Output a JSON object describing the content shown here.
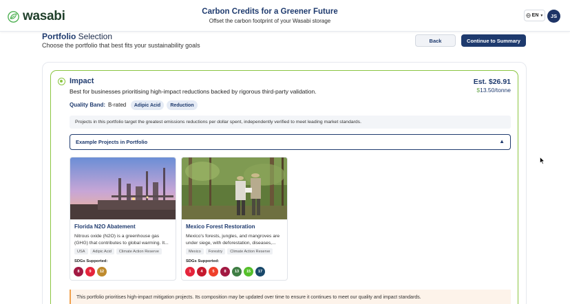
{
  "header": {
    "logo_text": "wasabi",
    "title": "Carbon Credits for a Greener Future",
    "subtitle": "Offset the carbon footprint of your Wasabi storage",
    "language": "EN",
    "avatar_initials": "JS"
  },
  "page": {
    "title_bold": "Portfolio",
    "title_rest": " Selection",
    "subtitle": "Choose the portfolio that best fits your sustainability goals",
    "back_label": "Back",
    "continue_label": "Continue to Summary"
  },
  "portfolio": {
    "name": "Impact",
    "description": "Best for businesses prioritising high-impact reductions backed by rigorous third-party validation.",
    "estimate": "Est. $26.91",
    "price_symbol": "$",
    "price_rest": "13.50/tonne",
    "quality_label": "Quality Band:",
    "quality_value": "B-rated",
    "tags": [
      "Adipic Acid",
      "Reduction"
    ],
    "info_text": "Projects in this portfolio target the greatest emissions reductions per dollar spent, independently verified to meet leading market standards.",
    "accordion_label": "Example Projects in Portfolio",
    "notice": "This portfolio prioritises high-impact mitigation projects. Its composition may be updated over time to ensure it continues to meet our quality and impact standards."
  },
  "projects": [
    {
      "title": "Florida N2O Abatement",
      "description": "Nitrous oxide (N2O) is a greenhouse gas (GHG) that contributes to global warming. It...",
      "tags": [
        "USA",
        "Adipic Acid",
        "Climate Action Reserve"
      ],
      "sdg_label": "SDGs Supported:",
      "sdgs": [
        {
          "num": "8",
          "color": "#a21942"
        },
        {
          "num": "9",
          "color": "#e5243b"
        },
        {
          "num": "12",
          "color": "#bf8b2e"
        }
      ]
    },
    {
      "title": "Mexico Forest Restoration",
      "description": "Mexico's forests, jungles, and mangroves are under siege, with deforestation, diseases,...",
      "tags": [
        "Mexico",
        "Forestry",
        "Climate Action Reserve"
      ],
      "sdg_label": "SDGs Supported:",
      "sdgs": [
        {
          "num": "1",
          "color": "#e5243b"
        },
        {
          "num": "4",
          "color": "#c5192d"
        },
        {
          "num": "5",
          "color": "#ef402b"
        },
        {
          "num": "8",
          "color": "#a21942"
        },
        {
          "num": "13",
          "color": "#3f7e44"
        },
        {
          "num": "15",
          "color": "#56c02b"
        },
        {
          "num": "17",
          "color": "#19486a"
        }
      ]
    }
  ],
  "colors": {
    "accent_green": "#8ac540",
    "navy": "#1e3a6e"
  }
}
